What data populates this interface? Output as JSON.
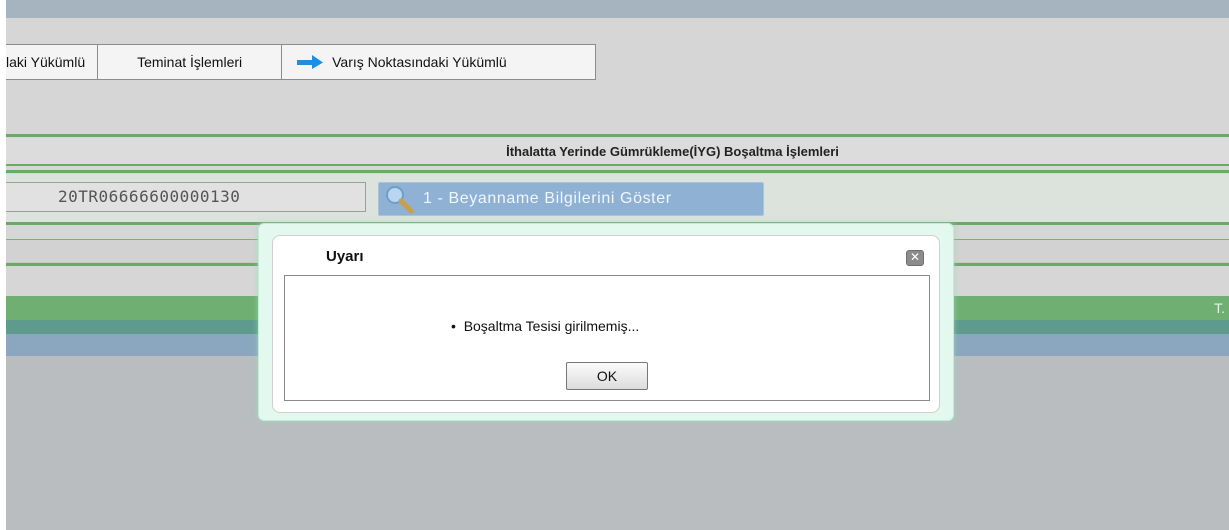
{
  "tabs": [
    {
      "label": "laki Yükümlü"
    },
    {
      "label": "Teminat İşlemleri"
    },
    {
      "label": "Varış Noktasındaki Yükümlü",
      "icon": "arrow-right-icon"
    }
  ],
  "section": {
    "title": "İthalatta Yerinde Gümrükleme(İYG) Boşaltma İşlemleri",
    "declaration_number": "20TR06666600000130",
    "show_button_label": "1 - Beyanname Bilgilerini Göster",
    "show_button_icon": "magnifier-icon"
  },
  "band_text": "T.",
  "dialog": {
    "title": "Uyarı",
    "message": "Boşaltma Tesisi girilmemiş...",
    "bullet": "•",
    "ok_label": "OK",
    "close_icon": "close-icon"
  },
  "colors": {
    "accent_green": "#6aa968",
    "button_blue": "#8fb1d3",
    "dialog_glow": "#e3f8ef"
  }
}
